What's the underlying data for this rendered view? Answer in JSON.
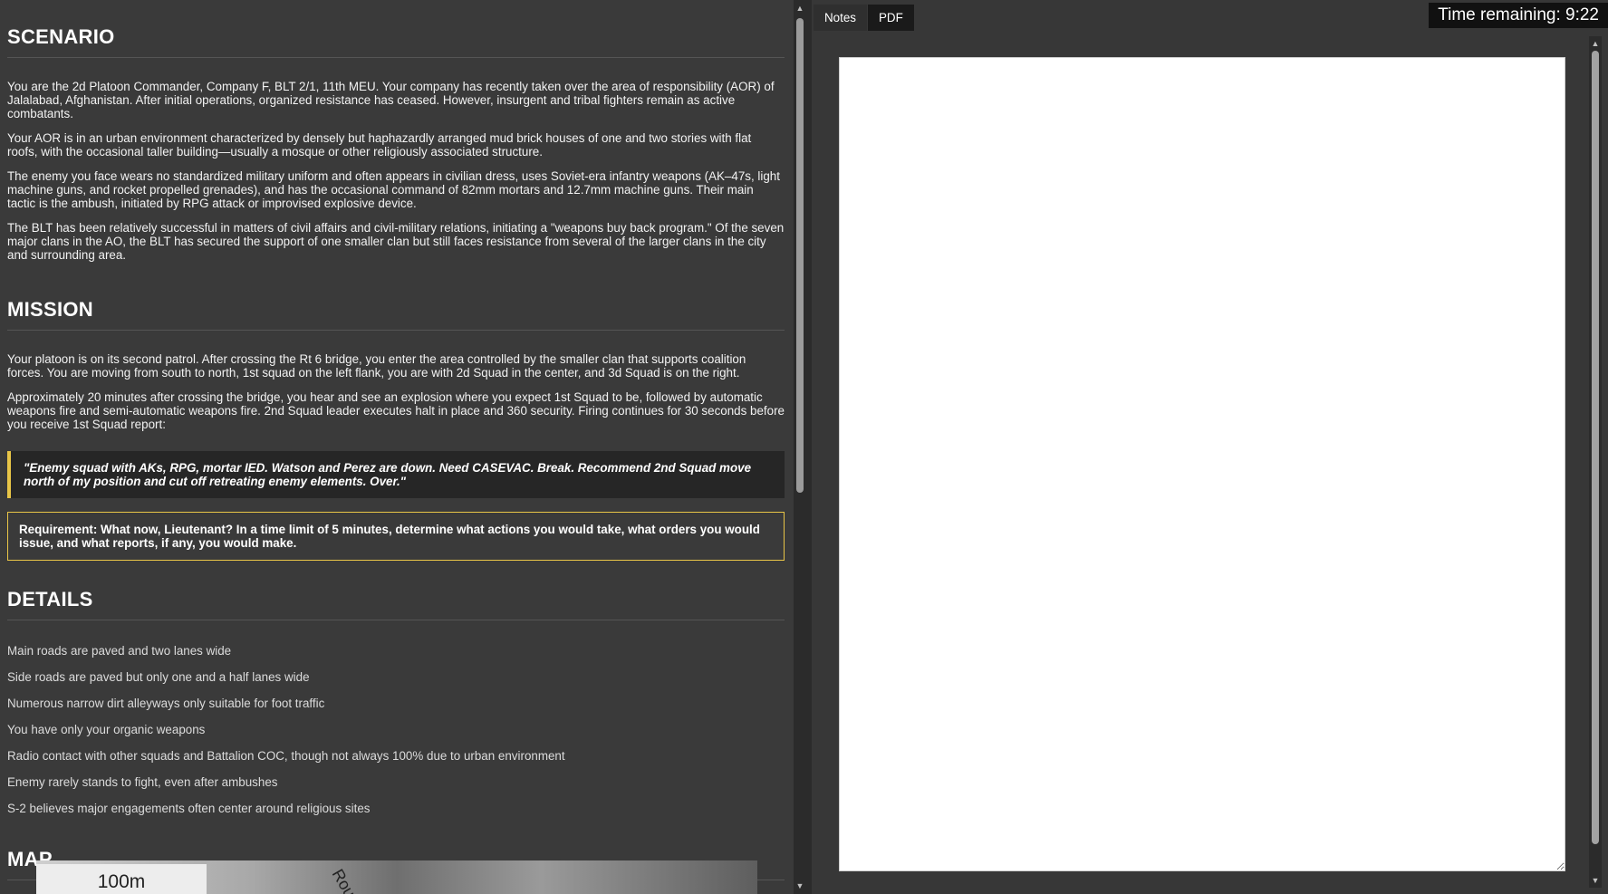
{
  "scenario": {
    "title": "SCENARIO",
    "paragraphs": [
      "You are the 2d Platoon Commander, Company F, BLT 2/1, 11th MEU. Your company has recently taken over the area of responsibility (AOR) of Jalalabad, Afghanistan. After initial operations, organized resistance has ceased. However, insurgent and tribal fighters remain as active combatants.",
      "Your AOR is in an urban environment characterized by densely but haphazardly arranged mud brick houses of one and two stories with flat roofs, with the occasional taller building—usually a mosque or other religiously associated structure.",
      "The enemy you face wears no standardized military uniform and often appears in civilian dress, uses Soviet-era infantry weapons (AK–47s, light machine guns, and rocket propelled grenades), and has the occasional command of 82mm mortars and 12.7mm machine guns. Their main tactic is the ambush, initiated by RPG attack or improvised explosive device.",
      "The BLT has been relatively successful in matters of civil affairs and civil-military relations, initiating a \"weapons buy back program.\" Of the seven major clans in the AO, the BLT has secured the support of one smaller clan but still faces resistance from several of the larger clans in the city and surrounding area."
    ]
  },
  "mission": {
    "title": "MISSION",
    "paragraphs": [
      "Your platoon is on its second patrol. After crossing the Rt 6 bridge, you enter the area controlled by the smaller clan that supports coalition forces. You are moving from south to north, 1st squad on the left flank, you are with 2d Squad in the center, and 3d Squad is on the right.",
      "Approximately 20 minutes after crossing the bridge, you hear and see an explosion where you expect 1st Squad to be, followed by automatic weapons fire and semi-automatic weapons fire. 2nd Squad leader executes halt in place and 360 security. Firing continues for 30 seconds before you receive 1st Squad report:"
    ],
    "quote": "\"Enemy squad with AKs, RPG, mortar IED. Watson and Perez are down. Need CASEVAC. Break. Recommend 2nd Squad move north of my position and cut off retreating enemy elements. Over.\"",
    "requirement": "Requirement: What now, Lieutenant? In a time limit of 5 minutes, determine what actions you would take, what orders you would issue, and what reports, if any, you would make."
  },
  "details": {
    "title": "DETAILS",
    "items": [
      "Main roads are paved and two lanes wide",
      "Side roads are paved but only one and a half lanes wide",
      "Numerous narrow dirt alleyways only suitable for foot traffic",
      "You have only your organic weapons",
      "Radio contact with other squads and Battalion COC, though not always 100% due to urban environment",
      "Enemy rarely stands to fight, even after ambushes",
      "S-2 believes major engagements often center around religious sites"
    ]
  },
  "map": {
    "title": "MAP",
    "scale_label": "100m",
    "road_label": "Rou"
  },
  "tabs": [
    {
      "label": "Notes"
    },
    {
      "label": "PDF"
    }
  ],
  "timer": {
    "label": "Time remaining: 9:22"
  },
  "colors": {
    "accent": "#e8c547",
    "background": "#3a3a3a",
    "notes_bg": "#ffffff"
  }
}
